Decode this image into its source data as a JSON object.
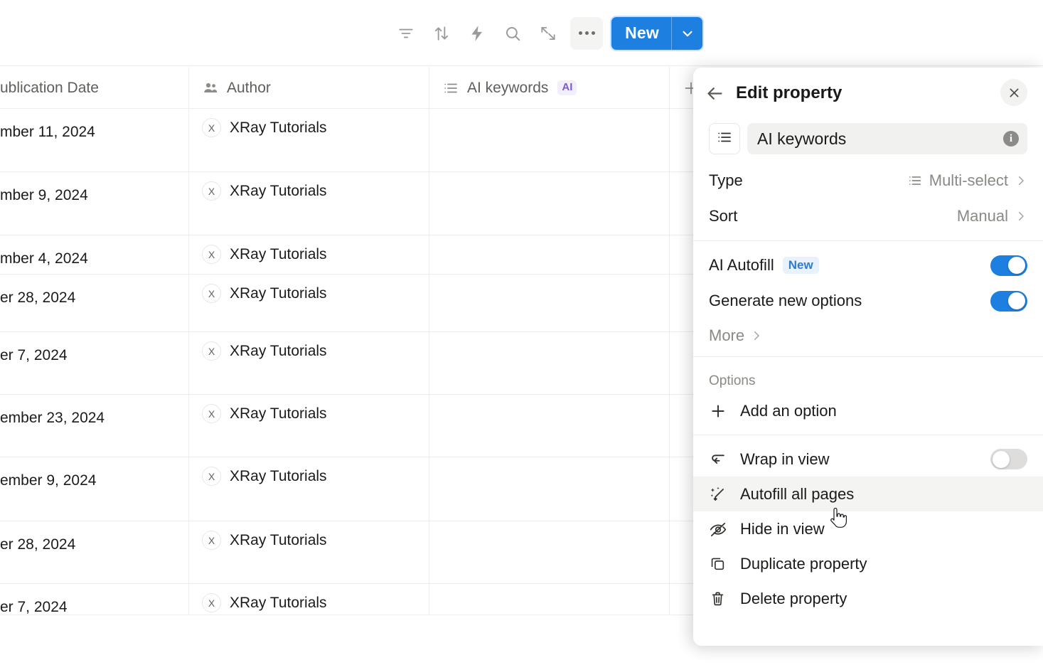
{
  "toolbar": {
    "icons": [
      {
        "name": "filter-icon",
        "label": "Filter"
      },
      {
        "name": "sort-icon",
        "label": "Sort"
      },
      {
        "name": "automation-icon",
        "label": "Automations"
      },
      {
        "name": "search-icon",
        "label": "Search"
      },
      {
        "name": "expand-icon",
        "label": "Expand"
      }
    ],
    "more_label": "More options",
    "new_label": "New",
    "new_caret": "chevron-down-icon",
    "new_button_color": "#1d7fe0"
  },
  "table": {
    "columns": [
      {
        "key": "date",
        "header": "ublication Date",
        "icon": null
      },
      {
        "key": "author",
        "header": "Author",
        "icon": "people-icon"
      },
      {
        "key": "keywords",
        "header": "AI keywords",
        "icon": "list-icon",
        "badge": "AI",
        "badge_color": "#7b5ec7"
      }
    ],
    "add_column_label": "+",
    "rows": [
      {
        "date": "mber 11, 2024",
        "author": "XRay Tutorials",
        "avatar": "X",
        "keywords": ""
      },
      {
        "date": "mber 9, 2024",
        "author": "XRay Tutorials",
        "avatar": "X",
        "keywords": ""
      },
      {
        "date": "mber 4, 2024",
        "author": "XRay Tutorials",
        "avatar": "X",
        "keywords": ""
      },
      {
        "date": "er 28, 2024",
        "author": "XRay Tutorials",
        "avatar": "X",
        "keywords": ""
      },
      {
        "date": "er 7, 2024",
        "author": "XRay Tutorials",
        "avatar": "X",
        "keywords": ""
      },
      {
        "date": "ember 23, 2024",
        "author": "XRay Tutorials",
        "avatar": "X",
        "keywords": ""
      },
      {
        "date": "ember 9, 2024",
        "author": "XRay Tutorials",
        "avatar": "X",
        "keywords": ""
      },
      {
        "date": "er 28, 2024",
        "author": "XRay Tutorials",
        "avatar": "X",
        "keywords": ""
      },
      {
        "date": "er 7, 2024",
        "author": "XRay Tutorials",
        "avatar": "X",
        "keywords": ""
      }
    ]
  },
  "panel": {
    "title": "Edit property",
    "back_icon": "arrow-left-icon",
    "close_icon": "close-icon",
    "property_name": "AI keywords",
    "property_type_icon": "list-icon",
    "info_icon": "info-icon",
    "type_label": "Type",
    "type_value": "Multi-select",
    "sort_label": "Sort",
    "sort_value": "Manual",
    "ai_autofill_label": "AI Autofill",
    "ai_autofill_badge": "New",
    "ai_autofill_on": true,
    "generate_options_label": "Generate new options",
    "generate_options_on": true,
    "more_label": "More",
    "options_section_label": "Options",
    "add_option_label": "Add an option",
    "menu": [
      {
        "label": "Wrap in view",
        "icon": "wrap-icon",
        "toggle": false
      },
      {
        "label": "Autofill all pages",
        "icon": "sparkle-wand-icon",
        "highlighted": true
      },
      {
        "label": "Hide in view",
        "icon": "eye-off-icon"
      },
      {
        "label": "Duplicate property",
        "icon": "duplicate-icon"
      },
      {
        "label": "Delete property",
        "icon": "trash-icon"
      }
    ]
  }
}
